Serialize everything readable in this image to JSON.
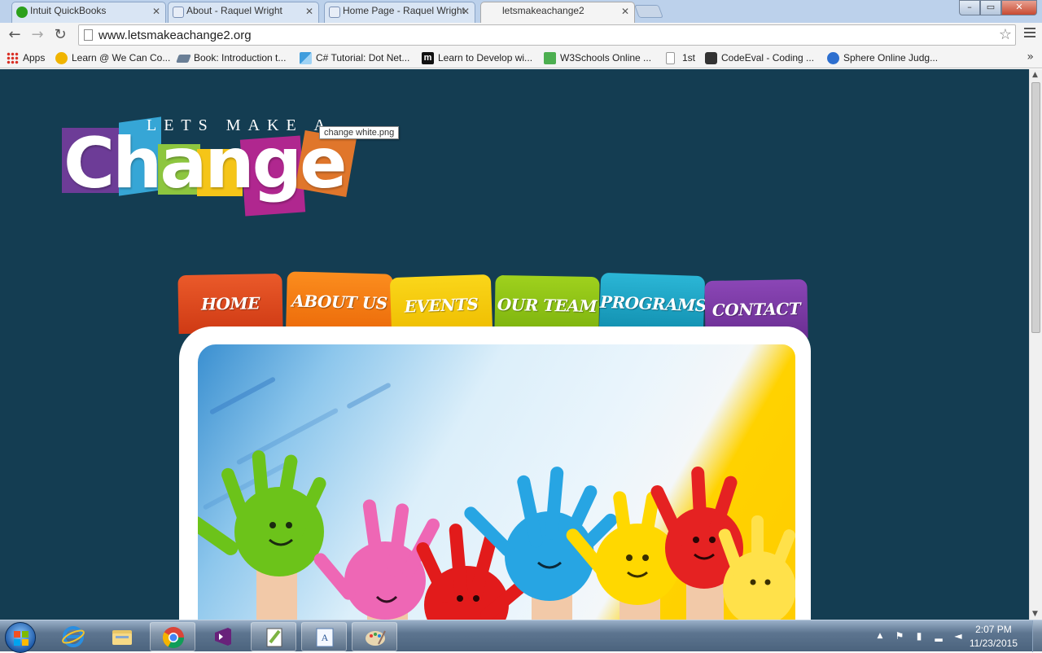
{
  "browser": {
    "tabs": [
      {
        "title": "Intuit QuickBooks",
        "icon": "quickbooks-icon",
        "icon_color": "#2ca01c"
      },
      {
        "title": "About - Raquel Wright",
        "icon": "page-icon",
        "icon_color": "#7a90b5"
      },
      {
        "title": "Home Page - Raquel Wright",
        "icon": "page-icon",
        "icon_color": "#7a90b5"
      },
      {
        "title": "letsmakeachange2",
        "icon": "none",
        "active": true
      }
    ],
    "window_controls": {
      "minimize": "–",
      "maximize": "▭",
      "close": "✕"
    },
    "url": "www.letsmakeachange2.org",
    "bookmarks": [
      {
        "label": "Apps",
        "icon": "apps-grid-icon",
        "color": "#d93025"
      },
      {
        "label": "Learn @ We Can Co...",
        "icon": "we-can-code-icon",
        "color": "#f0b400"
      },
      {
        "label": "Book: Introduction t...",
        "icon": "book-icon",
        "color": "#6a7f96"
      },
      {
        "label": "C# Tutorial: Dot Net...",
        "icon": "dotnet-icon",
        "color": "#3f9ddd"
      },
      {
        "label": "Learn to Develop wi...",
        "icon": "m-icon",
        "color": "#111111"
      },
      {
        "label": "W3Schools Online ...",
        "icon": "w3schools-icon",
        "color": "#4caf50"
      },
      {
        "label": "1st",
        "icon": "page-icon",
        "color": "#cccccc"
      },
      {
        "label": "CodeEval - Coding ...",
        "icon": "codeeval-icon",
        "color": "#333333"
      },
      {
        "label": "Sphere Online Judg...",
        "icon": "sphere-icon",
        "color": "#2d6fcf"
      }
    ],
    "bookmarks_more": "»"
  },
  "site": {
    "background": "#143d52",
    "logo": {
      "tagline": "LETS MAKE A",
      "word": "Change",
      "tooltip": "change white.png"
    },
    "nav": [
      {
        "label": "HOME",
        "color": "#e5461f"
      },
      {
        "label": "ABOUT US",
        "color": "#f37b12"
      },
      {
        "label": "EVENTS",
        "color": "#f6c900"
      },
      {
        "label": "OUR TEAM",
        "color": "#8fc414"
      },
      {
        "label": "PROGRAMS",
        "color": "#1aa3c4"
      },
      {
        "label": "CONTACT",
        "color": "#7b3aa3"
      }
    ]
  },
  "taskbar": {
    "apps": [
      {
        "name": "internet-explorer-icon",
        "running": false
      },
      {
        "name": "file-explorer-icon",
        "running": false
      },
      {
        "name": "chrome-icon",
        "running": true
      },
      {
        "name": "visual-studio-icon",
        "running": false
      },
      {
        "name": "notepad-plus-icon",
        "running": true
      },
      {
        "name": "wordpad-icon",
        "running": true
      },
      {
        "name": "paint-icon",
        "running": true
      }
    ],
    "time": "2:07 PM",
    "date": "11/23/2015"
  }
}
